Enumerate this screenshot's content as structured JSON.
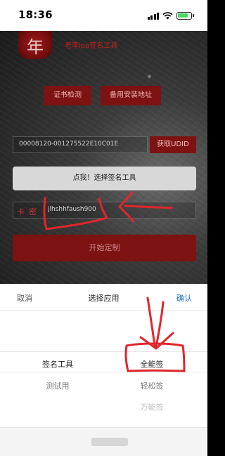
{
  "status_bar": {
    "time": "18:36"
  },
  "app": {
    "title": "老李ipa签名工具",
    "logo_glyph": "年",
    "buttons": {
      "cert_check": "证书检测",
      "backup_addr": "备用安装地址"
    },
    "udid": {
      "value": "00008120-001275522E10C01E",
      "button": "获取UDID"
    },
    "select_button": "点我！选择签名工具",
    "card": {
      "label": "卡密",
      "value": "jlhshhfaush900"
    },
    "start_button": "开始定制"
  },
  "picker": {
    "cancel": "取消",
    "title": "选择应用",
    "confirm": "确认",
    "left_column": [
      "签名工具",
      "测试用"
    ],
    "right_column": [
      "全能签",
      "轻松签",
      "万能签"
    ]
  },
  "colors": {
    "accent_red": "#7d1212",
    "annotation_red": "#e0262d",
    "confirm_blue": "#1a73c9"
  }
}
